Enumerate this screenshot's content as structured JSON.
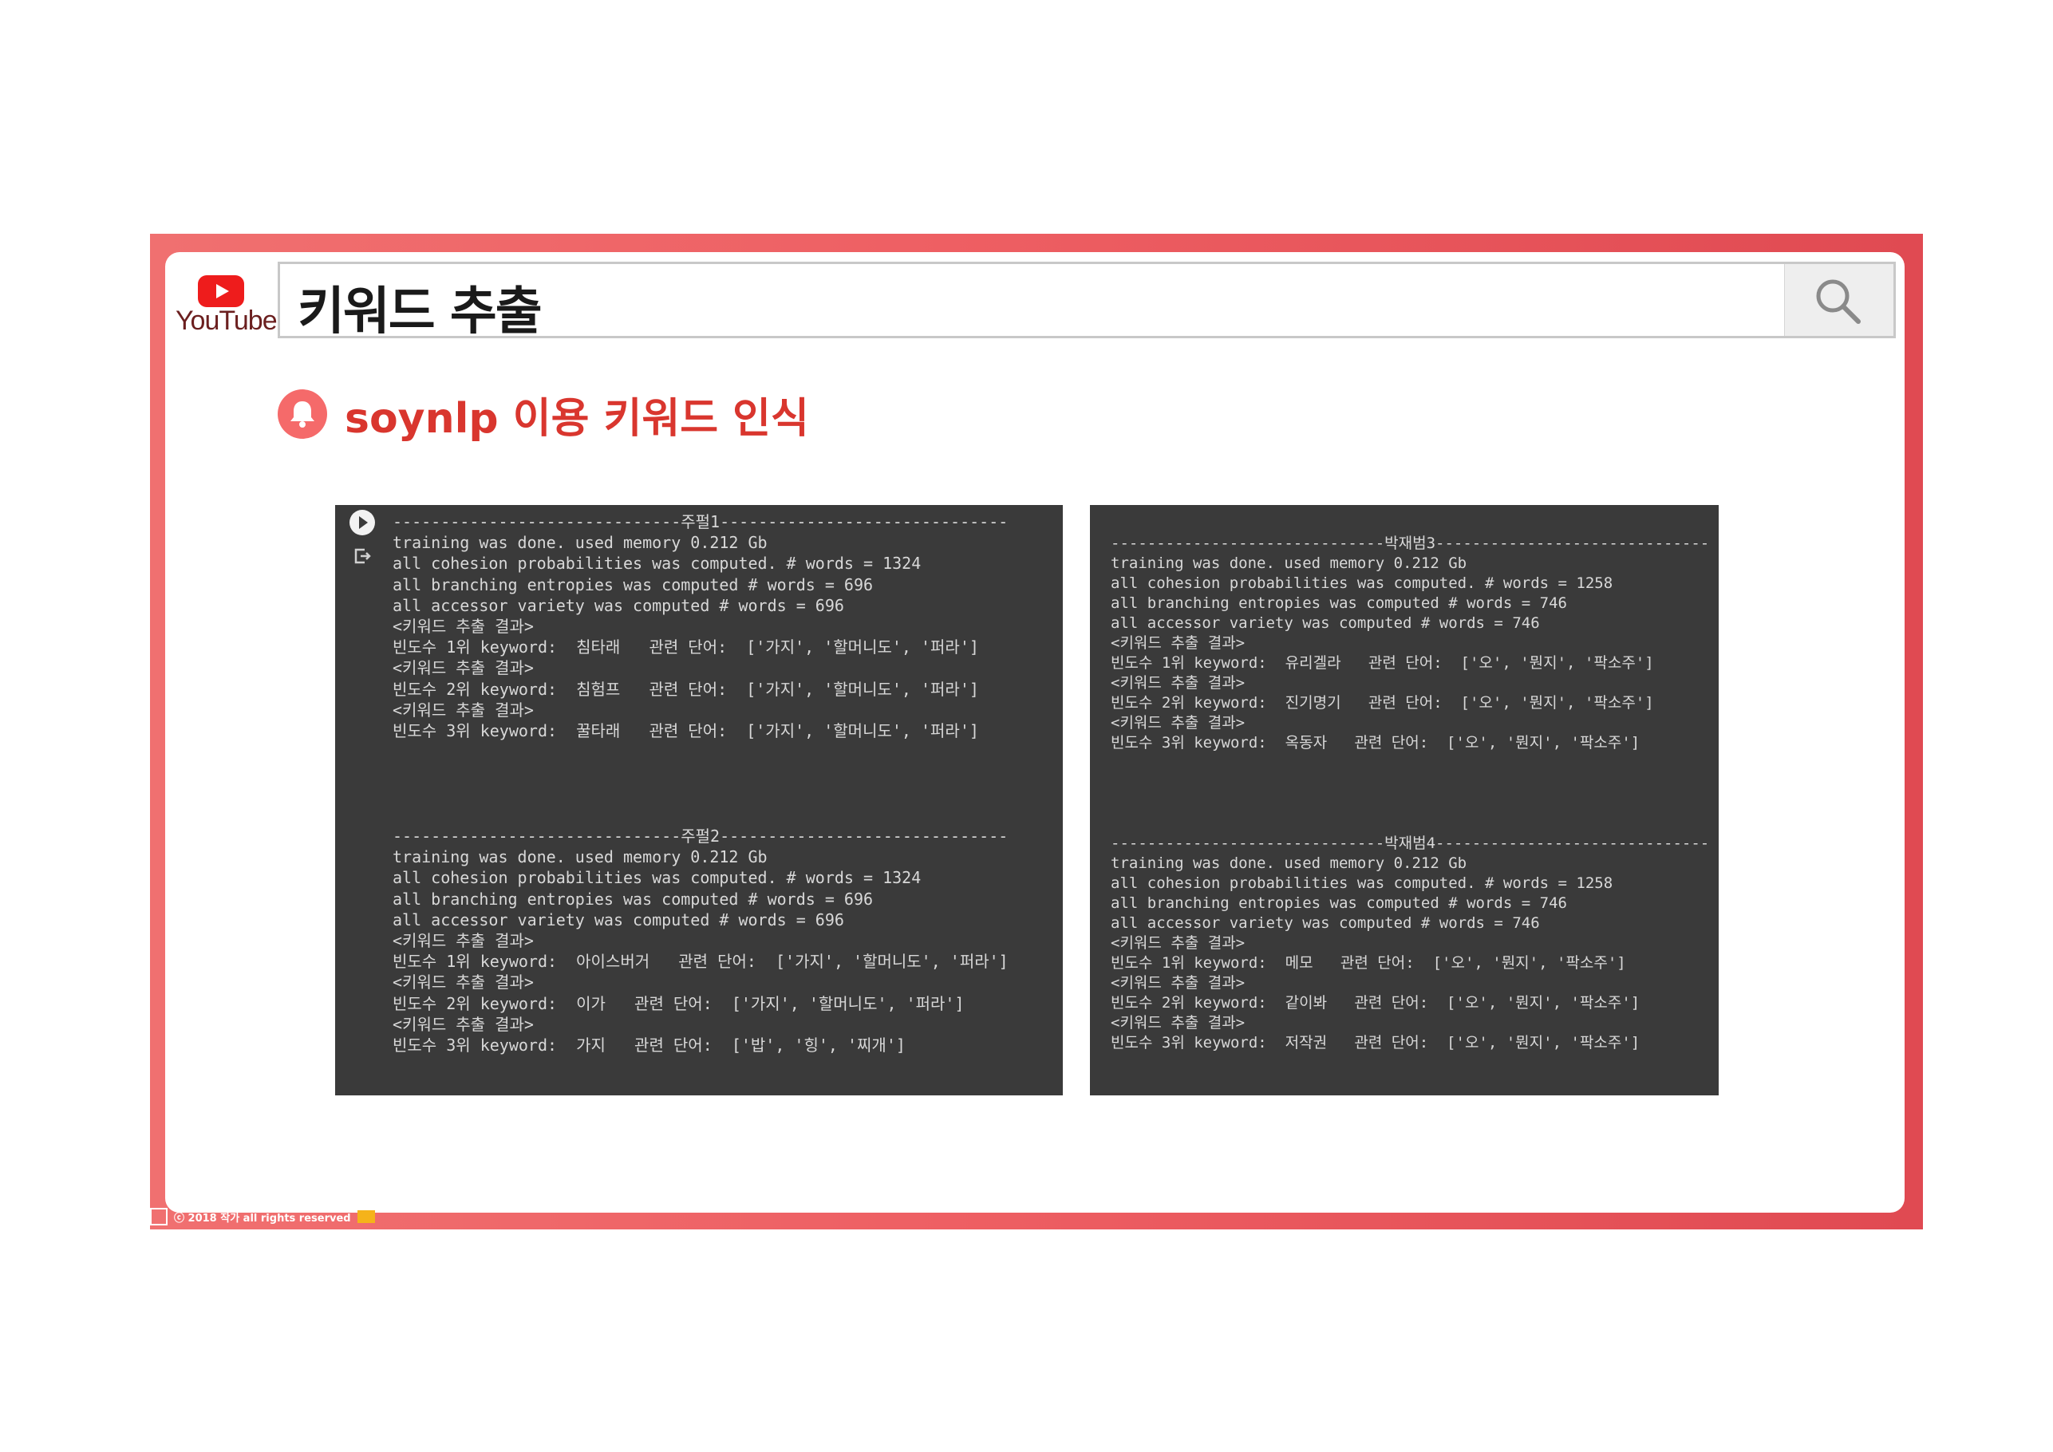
{
  "brand": {
    "logo_text": "YouTube"
  },
  "search": {
    "query": "키워드 추출"
  },
  "section": {
    "title": "soynlp 이용 키워드 인식"
  },
  "footer": {
    "copyright": "ⓒ 2018 작가 all rights reserved"
  },
  "terminals": {
    "left": {
      "blocks": [
        {
          "lines": [
            "------------------------------주펄1------------------------------",
            "training was done. used memory 0.212 Gb",
            "all cohesion probabilities was computed. # words = 1324",
            "all branching entropies was computed # words = 696",
            "all accessor variety was computed # words = 696",
            "<키워드 추출 결과>",
            "빈도수 1위 keyword:  침타래   관련 단어:  ['가지', '할머니도', '퍼라']",
            "<키워드 추출 결과>",
            "빈도수 2위 keyword:  침험프   관련 단어:  ['가지', '할머니도', '퍼라']",
            "<키워드 추출 결과>",
            "빈도수 3위 keyword:  꿀타래   관련 단어:  ['가지', '할머니도', '퍼라']"
          ]
        },
        {
          "lines": [
            "------------------------------주펄2------------------------------",
            "training was done. used memory 0.212 Gb",
            "all cohesion probabilities was computed. # words = 1324",
            "all branching entropies was computed # words = 696",
            "all accessor variety was computed # words = 696",
            "<키워드 추출 결과>",
            "빈도수 1위 keyword:  아이스버거   관련 단어:  ['가지', '할머니도', '퍼라']",
            "<키워드 추출 결과>",
            "빈도수 2위 keyword:  이가   관련 단어:  ['가지', '할머니도', '퍼라']",
            "<키워드 추출 결과>",
            "빈도수 3위 keyword:  가지   관련 단어:  ['밥', '힝', '찌개']"
          ]
        }
      ]
    },
    "right": {
      "blocks": [
        {
          "lines": [
            "------------------------------박재범3------------------------------",
            "training was done. used memory 0.212 Gb",
            "all cohesion probabilities was computed. # words = 1258",
            "all branching entropies was computed # words = 746",
            "all accessor variety was computed # words = 746",
            "<키워드 추출 결과>",
            "빈도수 1위 keyword:  유리겔라   관련 단어:  ['오', '뭔지', '팍소주']",
            "<키워드 추출 결과>",
            "빈도수 2위 keyword:  진기명기   관련 단어:  ['오', '뭔지', '팍소주']",
            "<키워드 추출 결과>",
            "빈도수 3위 keyword:  옥동자   관련 단어:  ['오', '뭔지', '팍소주']"
          ]
        },
        {
          "lines": [
            "------------------------------박재범4------------------------------",
            "training was done. used memory 0.212 Gb",
            "all cohesion probabilities was computed. # words = 1258",
            "all branching entropies was computed # words = 746",
            "all accessor variety was computed # words = 746",
            "<키워드 추출 결과>",
            "빈도수 1위 keyword:  메모   관련 단어:  ['오', '뭔지', '팍소주']",
            "<키워드 추출 결과>",
            "빈도수 2위 keyword:  같이봐   관련 단어:  ['오', '뭔지', '팍소주']",
            "<키워드 추출 결과>",
            "빈도수 3위 keyword:  저작권   관련 단어:  ['오', '뭔지', '팍소주']"
          ]
        }
      ]
    }
  }
}
